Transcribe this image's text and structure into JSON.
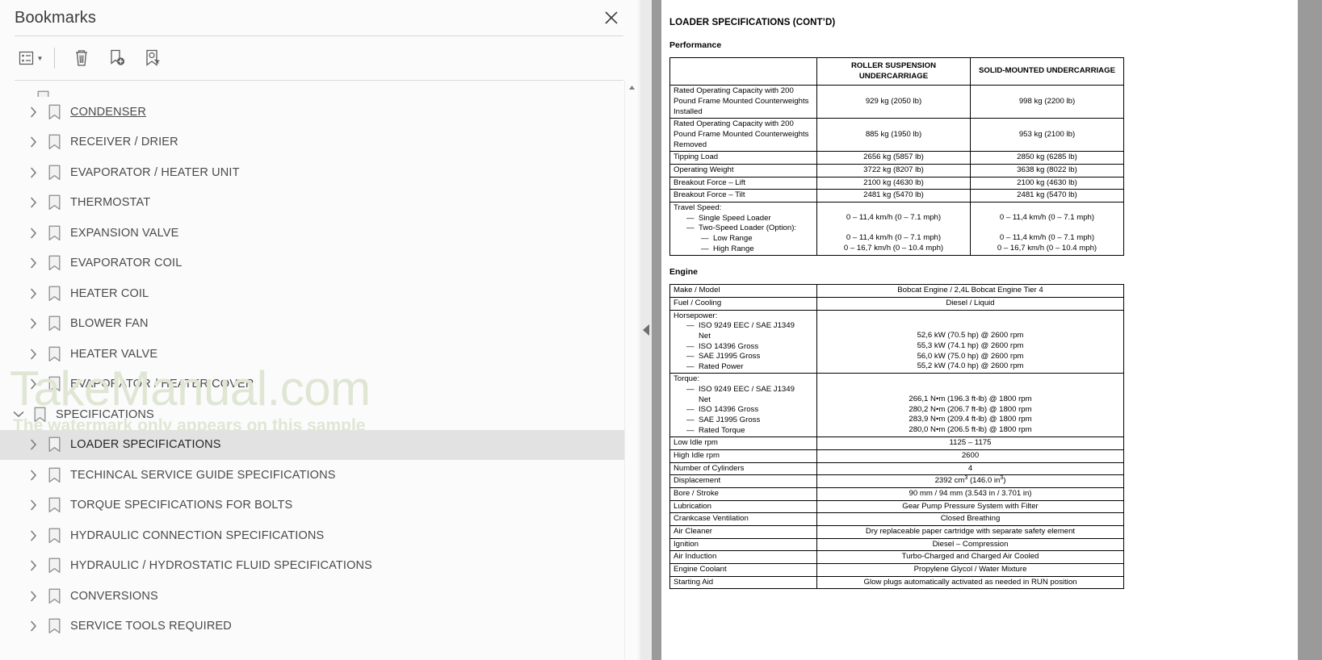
{
  "bookmarks_panel": {
    "title": "Bookmarks",
    "close_icon": "close-icon",
    "toolbar": [
      {
        "name": "list-options-button",
        "icon": "list-options-icon",
        "has_caret": true
      },
      {
        "name": "delete-bookmark-button",
        "icon": "trash-icon",
        "has_caret": false
      },
      {
        "name": "new-bookmark-button",
        "icon": "bookmark-plus-icon",
        "has_caret": false
      },
      {
        "name": "edit-bookmark-button",
        "icon": "bookmark-edit-icon",
        "has_caret": false
      }
    ],
    "items": [
      {
        "label": "CONDENSER",
        "expanded": false,
        "selected": false,
        "linked": true,
        "level": 1
      },
      {
        "label": "RECEIVER / DRIER",
        "expanded": false,
        "selected": false,
        "linked": false,
        "level": 1
      },
      {
        "label": "EVAPORATOR / HEATER UNIT",
        "expanded": false,
        "selected": false,
        "linked": false,
        "level": 1
      },
      {
        "label": "THERMOSTAT",
        "expanded": false,
        "selected": false,
        "linked": false,
        "level": 1
      },
      {
        "label": "EXPANSION VALVE",
        "expanded": false,
        "selected": false,
        "linked": false,
        "level": 1
      },
      {
        "label": "EVAPORATOR COIL",
        "expanded": false,
        "selected": false,
        "linked": false,
        "level": 1
      },
      {
        "label": "HEATER COIL",
        "expanded": false,
        "selected": false,
        "linked": false,
        "level": 1
      },
      {
        "label": "BLOWER FAN",
        "expanded": false,
        "selected": false,
        "linked": false,
        "level": 1
      },
      {
        "label": "HEATER VALVE",
        "expanded": false,
        "selected": false,
        "linked": false,
        "level": 1
      },
      {
        "label": "EVAPORATOR / HEATER COVER",
        "expanded": false,
        "selected": false,
        "linked": false,
        "level": 1
      },
      {
        "label": "SPECIFICATIONS",
        "expanded": true,
        "selected": false,
        "linked": false,
        "level": 0
      },
      {
        "label": "LOADER SPECIFICATIONS",
        "expanded": false,
        "selected": true,
        "linked": false,
        "level": 1
      },
      {
        "label": "TECHINCAL SERVICE GUIDE SPECIFICATIONS",
        "expanded": false,
        "selected": false,
        "linked": false,
        "level": 1
      },
      {
        "label": "TORQUE SPECIFICATIONS FOR BOLTS",
        "expanded": false,
        "selected": false,
        "linked": false,
        "level": 1
      },
      {
        "label": "HYDRAULIC CONNECTION SPECIFICATIONS",
        "expanded": false,
        "selected": false,
        "linked": false,
        "level": 1
      },
      {
        "label": "HYDRAULIC / HYDROSTATIC FLUID SPECIFICATIONS",
        "expanded": false,
        "selected": false,
        "linked": false,
        "level": 1
      },
      {
        "label": "CONVERSIONS",
        "expanded": false,
        "selected": false,
        "linked": false,
        "level": 1
      },
      {
        "label": "SERVICE TOOLS REQUIRED",
        "expanded": false,
        "selected": false,
        "linked": false,
        "level": 1
      }
    ]
  },
  "watermark": {
    "main": "TakeManual.com",
    "sub": "The watermark only appears on this sample",
    "color": "#dfe6d4"
  },
  "splitter": {
    "name": "collapse-panel-handle",
    "icon": "triangle-left-icon"
  },
  "document": {
    "heading": "LOADER SPECIFICATIONS (CONT’D)",
    "performance": {
      "section_title": "Performance",
      "columns": [
        "",
        "ROLLER SUSPENSION UNDERCARRIAGE",
        "SOLID-MOUNTED UNDERCARRIAGE"
      ],
      "rows": [
        {
          "label": "Rated Operating Capacity with 200 Pound Frame Mounted Counterweights Installed",
          "roller": "929 kg (2050 lb)",
          "solid": "998 kg (2200 lb)",
          "tall": true
        },
        {
          "label": "Rated Operating Capacity with 200 Pound Frame Mounted Counterweights Removed",
          "roller": "885 kg (1950 lb)",
          "solid": "953 kg (2100 lb)",
          "tall": true
        },
        {
          "label": "Tipping Load",
          "roller": "2656 kg (5857 lb)",
          "solid": "2850 kg (6285 lb)",
          "tall": false
        },
        {
          "label": "Operating Weight",
          "roller": "3722 kg (8207 lb)",
          "solid": "3638 kg (8022 lb)",
          "tall": false
        },
        {
          "label": "Breakout Force – Lift",
          "roller": "2100 kg (4630 lb)",
          "solid": "2100 kg (4630 lb)",
          "tall": false
        },
        {
          "label": "Breakout Force – Tilt",
          "roller": "2481 kg (5470 lb)",
          "solid": "2481 kg (5470 lb)",
          "tall": false
        }
      ],
      "travel_speed": {
        "heading": "Travel Speed:",
        "entries": [
          {
            "label": "Single Speed Loader",
            "indent": 1,
            "roller": "0 – 11,4 km/h (0 – 7.1 mph)",
            "solid": "0 – 11,4 km/h (0 – 7.1 mph)"
          },
          {
            "label": "Two-Speed Loader (Option):",
            "indent": 1,
            "roller": "",
            "solid": ""
          },
          {
            "label": "Low Range",
            "indent": 2,
            "roller": "0 – 11,4 km/h (0 – 7.1 mph)",
            "solid": "0 – 11,4 km/h (0 – 7.1 mph)"
          },
          {
            "label": "High Range",
            "indent": 2,
            "roller": "0 – 16,7 km/h (0 – 10.4 mph)",
            "solid": "0 – 16,7 km/h (0 – 10.4 mph)"
          }
        ]
      }
    },
    "engine": {
      "section_title": "Engine",
      "rows": [
        {
          "label": "Make / Model",
          "value": "Bobcat Engine / 2,4L Bobcat Engine Tier 4"
        },
        {
          "label": "Fuel / Cooling",
          "value": "Diesel / Liquid"
        },
        {
          "label": "Low Idle rpm",
          "value": "1125 – 1175"
        },
        {
          "label": "High Idle rpm",
          "value": "2600"
        },
        {
          "label": "Number of Cylinders",
          "value": "4"
        },
        {
          "label": "Displacement",
          "value": "2392 cm3 (146.0 in3)",
          "superscript": true
        },
        {
          "label": "Bore / Stroke",
          "value": "90 mm / 94 mm (3.543 in / 3.701 in)"
        },
        {
          "label": "Lubrication",
          "value": "Gear Pump Pressure System with Filter"
        },
        {
          "label": "Crankcase Ventilation",
          "value": "Closed Breathing"
        },
        {
          "label": "Air Cleaner",
          "value": "Dry replaceable paper cartridge with separate safety element"
        },
        {
          "label": "Ignition",
          "value": "Diesel – Compression"
        },
        {
          "label": "Air Induction",
          "value": "Turbo-Charged and Charged Air Cooled"
        },
        {
          "label": "Engine Coolant",
          "value": "Propylene Glycol / Water Mixture"
        },
        {
          "label": "Starting Aid",
          "value": "Glow plugs automatically activated as needed in RUN position"
        }
      ],
      "horsepower": {
        "heading": "Horsepower:",
        "entries": [
          {
            "label": "ISO 9249 EEC / SAE J1349 Net",
            "value": "52,6 kW (70.5 hp) @ 2600 rpm",
            "two_line": true
          },
          {
            "label": "ISO 14396 Gross",
            "value": "55,3 kW (74.1 hp) @ 2600 rpm",
            "two_line": false
          },
          {
            "label": "SAE J1995 Gross",
            "value": "56,0 kW (75.0 hp) @ 2600 rpm",
            "two_line": false
          },
          {
            "label": "Rated Power",
            "value": "55,2 kW (74.0 hp) @ 2600 rpm",
            "two_line": false
          }
        ]
      },
      "torque": {
        "heading": "Torque:",
        "entries": [
          {
            "label": "ISO 9249 EEC / SAE J1349 Net",
            "value": "266,1 N•m (196.3 ft-lb) @ 1800 rpm",
            "two_line": true
          },
          {
            "label": "ISO 14396 Gross",
            "value": "280,2 N•m (206.7 ft-lb) @ 1800 rpm",
            "two_line": false
          },
          {
            "label": "SAE J1995 Gross",
            "value": "283,9 N•m (209.4 ft-lb) @ 1800 rpm",
            "two_line": false
          },
          {
            "label": "Rated Torque",
            "value": "280,0 N•m (206.5 ft-lb) @ 1800 rpm",
            "two_line": false
          }
        ]
      }
    }
  }
}
